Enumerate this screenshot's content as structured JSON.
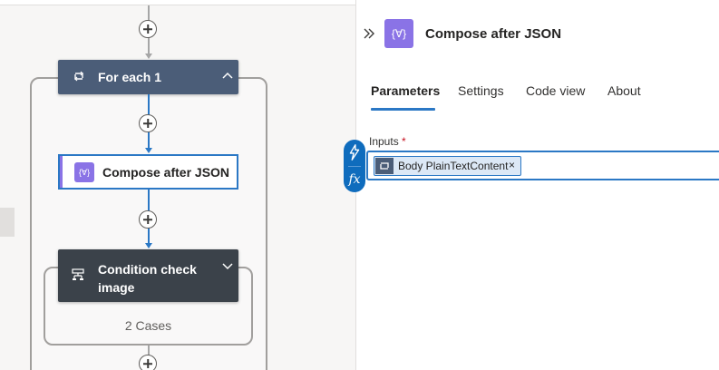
{
  "designer": {
    "foreach_card": {
      "title": "For each 1"
    },
    "compose_card": {
      "title": "Compose after JSON",
      "icon": "{∀}"
    },
    "condition_card": {
      "title_line1": "Condition check",
      "title_line2": "image",
      "cases": "2 Cases"
    }
  },
  "panel": {
    "title": "Compose after JSON",
    "icon": "{∀}",
    "tabs": [
      {
        "label": "Parameters",
        "active": true
      },
      {
        "label": "Settings",
        "active": false
      },
      {
        "label": "Code view",
        "active": false
      },
      {
        "label": "About",
        "active": false
      }
    ],
    "inputs_label": "Inputs",
    "required_marker": "*",
    "token": {
      "label": "Body PlainTextContent",
      "remove": "×"
    },
    "fx_label": "fx"
  },
  "colors": {
    "accent": "#2b78c5",
    "compose_purple": "#8a73e6",
    "foreach_header": "#4b5d78",
    "condition_header": "#3b424a"
  }
}
